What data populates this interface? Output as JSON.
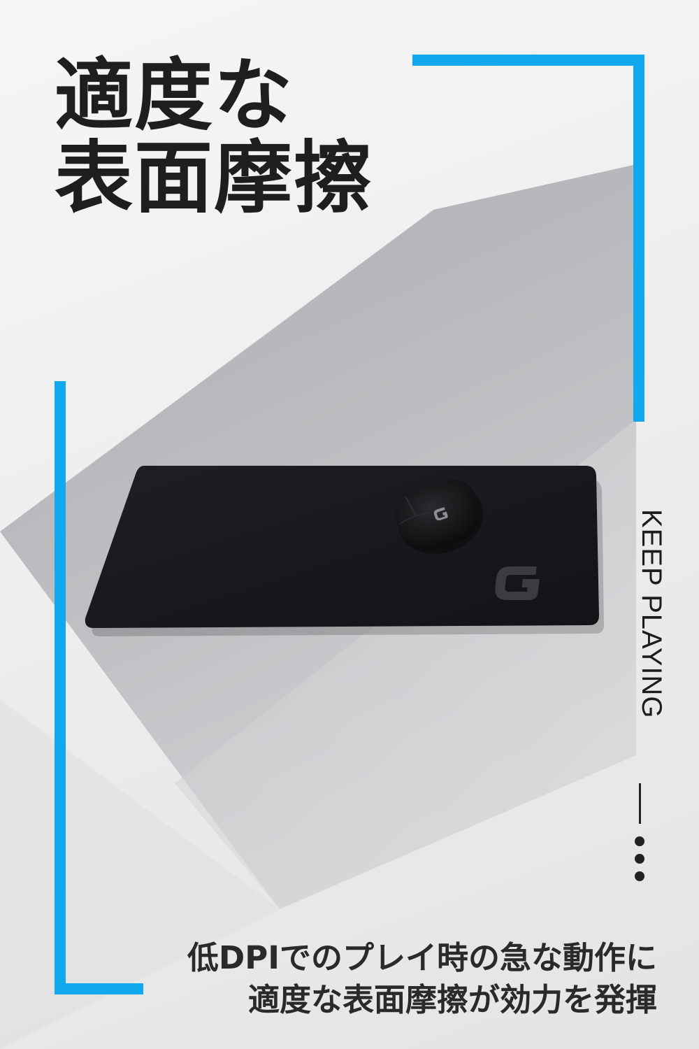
{
  "headline": {
    "line1": "適度な",
    "line2": "表面摩擦"
  },
  "vertical_tagline": "KEEP PLAYING",
  "caption": {
    "line1": "低DPIでのプレイ時の急な動作に",
    "line2": "適度な表面摩擦が効力を発揮"
  },
  "colors": {
    "accent_blue": "#11a8ee",
    "text_dark": "#1e1e1e",
    "mousepad": "#18191c",
    "logo_grey": "#3a3c40"
  },
  "icons": {
    "pad_logo": "g-logo-icon",
    "mouse_logo": "g-logo-icon"
  }
}
